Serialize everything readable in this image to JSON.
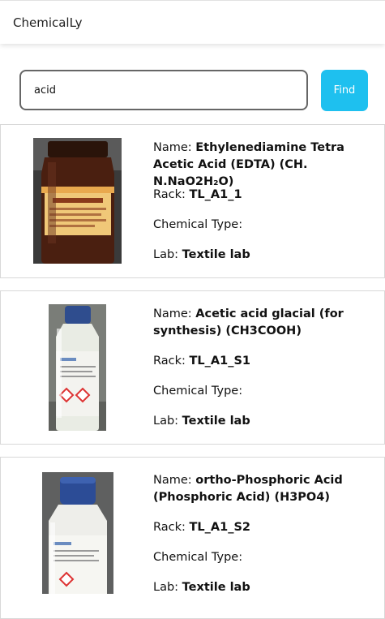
{
  "header": {
    "app_title": "ChemicalLy"
  },
  "search": {
    "value": "acid",
    "button_label": "Find"
  },
  "labels": {
    "name": "Name: ",
    "rack": "Rack: ",
    "chemical_type": "Chemical Type: ",
    "lab": "Lab: "
  },
  "results": [
    {
      "name": "Ethylenediamine Tetra Acetic Acid (EDTA) (CH. N.NaO2H₂O)",
      "rack": "TL_A1_1",
      "chemical_type": "",
      "lab": "Textile lab",
      "bottle_colors": {
        "bottle": "#4a1f10",
        "cap": "#3a1a0c",
        "label": "#e9a94e",
        "bg": "#2c2c2c"
      }
    },
    {
      "name": "Acetic acid glacial (for synthesis) (CH3COOH)",
      "rack": "TL_A1_S1",
      "chemical_type": "",
      "lab": "Textile lab",
      "bottle_colors": {
        "bottle": "#e9ece4",
        "cap": "#2f4d8e",
        "label": "#f3f3ef",
        "bg": "#7a7d78"
      }
    },
    {
      "name": "ortho-Phosphoric Acid (Phosphoric Acid) (H3PO4)",
      "rack": "TL_A1_S2",
      "chemical_type": "",
      "lab": "Textile lab",
      "bottle_colors": {
        "bottle": "#eeeeea",
        "cap": "#2c4c96",
        "label": "#f6f6f2",
        "bg": "#5f6060"
      }
    }
  ]
}
